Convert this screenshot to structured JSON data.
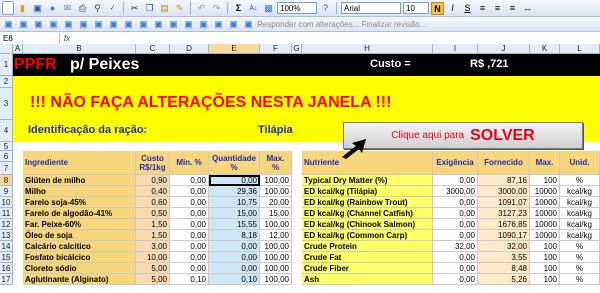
{
  "toolbar": {
    "zoom": "100%",
    "font": "Arial",
    "font_size": "10",
    "bold_label": "N",
    "review_text": "Responder com alterações...  Finalizar revisão..."
  },
  "formula_bar": {
    "name_box": "E8",
    "fx": "fx"
  },
  "columns": [
    "A",
    "B",
    "C",
    "D",
    "E",
    "F",
    "G",
    "H",
    "I",
    "J",
    "K",
    "L"
  ],
  "rows": [
    "1",
    "2",
    "3",
    "4",
    "5",
    "6",
    "7",
    "8",
    "9",
    "10",
    "11",
    "12",
    "13",
    "14",
    "15",
    "16",
    "17"
  ],
  "selected_column": "E",
  "selected_row": "8",
  "title": {
    "ppfr": "PPFR",
    "peixes": "p/ Peixes"
  },
  "custo": {
    "label": "Custo =",
    "value": "R$ ,721"
  },
  "warning": "!!!  NÃO FAÇA ALTERAÇÕES NESTA JANELA  !!!",
  "identificacao": {
    "label": "Identificação da ração:",
    "value": "Tilápia"
  },
  "solver": {
    "small": "Clique aqui para",
    "big": "SOLVER"
  },
  "ingredients_header": {
    "name": "Ingrediente",
    "custo": "Custo R$/1kg",
    "min": "Min. %",
    "quantidade": "Quantidade %",
    "max": "Max. %"
  },
  "ingredients": [
    {
      "name": "Glúten de milho",
      "custo": "0,90",
      "min": "0,00",
      "quantidade": "0,00",
      "max": "100,00"
    },
    {
      "name": "Milho",
      "custo": "0,40",
      "min": "0,00",
      "quantidade": "29,36",
      "max": "100,00"
    },
    {
      "name": "Farelo soja-45%",
      "custo": "0,60",
      "min": "0,00",
      "quantidade": "10,75",
      "max": "20,00"
    },
    {
      "name": "Farelo de algodão-41%",
      "custo": "0,50",
      "min": "0,00",
      "quantidade": "15,00",
      "max": "15,00"
    },
    {
      "name": "Far. Peixe-60%",
      "custo": "1,50",
      "min": "0,00",
      "quantidade": "15,55",
      "max": "100,00"
    },
    {
      "name": "Óleo de soja",
      "custo": "1,50",
      "min": "0,00",
      "quantidade": "8,18",
      "max": "12,00"
    },
    {
      "name": "Calcário calcítico",
      "custo": "3,00",
      "min": "0,00",
      "quantidade": "0,00",
      "max": "100,00"
    },
    {
      "name": "Fosfato bicálcico",
      "custo": "10,00",
      "min": "0,00",
      "quantidade": "0,00",
      "max": "100,00"
    },
    {
      "name": "Cloreto sódio",
      "custo": "5,00",
      "min": "0,00",
      "quantidade": "0,00",
      "max": "100,00"
    },
    {
      "name": "Aglutinante (Alginato)",
      "custo": "5,00",
      "min": "0,10",
      "quantidade": "0,10",
      "max": "100,00"
    }
  ],
  "nutrients_header": {
    "name": "Nutriente",
    "exigencia": "Exigência",
    "fornecido": "Fornecido",
    "max": "Max.",
    "unid": "Unid."
  },
  "nutrients": [
    {
      "name": "Typical Dry Matter (%)",
      "exigencia": "0,00",
      "fornecido": "87,16",
      "max": "100",
      "unid": "%"
    },
    {
      "name": "ED kcal/kg (Tilápia)",
      "exigencia": "3000,00",
      "fornecido": "3000,00",
      "max": "10000",
      "unid": "kcal/kg"
    },
    {
      "name": "ED kcal/kg (Rainbow Trout)",
      "exigencia": "0,00",
      "fornecido": "1091,07",
      "max": "10000",
      "unid": "kcal/kg"
    },
    {
      "name": "ED kcal/kg (Channel Catfish)",
      "exigencia": "0,00",
      "fornecido": "3127,23",
      "max": "10000",
      "unid": "kcal/kg"
    },
    {
      "name": "ED kcal/kg (Chinook Salmon)",
      "exigencia": "0,00",
      "fornecido": "1676,85",
      "max": "10000",
      "unid": "kcal/kg"
    },
    {
      "name": "ED kcal/kg (Common Carp)",
      "exigencia": "0,00",
      "fornecido": "1090,17",
      "max": "10000",
      "unid": "kcal/kg"
    },
    {
      "name": "Crude Protein",
      "exigencia": "32,00",
      "fornecido": "32,00",
      "max": "100",
      "unid": "%"
    },
    {
      "name": "Crude Fat",
      "exigencia": "0,00",
      "fornecido": "3,55",
      "max": "100",
      "unid": "%"
    },
    {
      "name": "Crude Fiber",
      "exigencia": "0,00",
      "fornecido": "8,48",
      "max": "100",
      "unid": "%"
    },
    {
      "name": "Ash",
      "exigencia": "0,00",
      "fornecido": "5,26",
      "max": "100",
      "unid": "%"
    }
  ]
}
